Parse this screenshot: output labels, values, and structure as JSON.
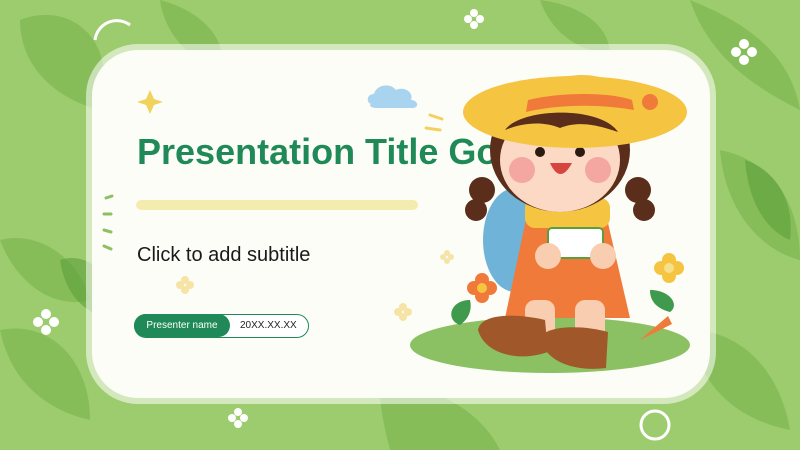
{
  "slide": {
    "title": "Presentation Title Goes Here",
    "subtitle": "Click to add subtitle",
    "presenter_label": "Presenter name",
    "date": "20XX.XX.XX"
  },
  "colors": {
    "background": "#9dcc6e",
    "card": "#fdfdf8",
    "accent_green": "#1f8a57",
    "underline_yellow": "#f4ecae"
  },
  "icons": {
    "illustration": "girl-with-straw-hat",
    "decorations": [
      "leaf-icon",
      "sparkle-icon",
      "cloud-icon",
      "flower-icon"
    ]
  }
}
